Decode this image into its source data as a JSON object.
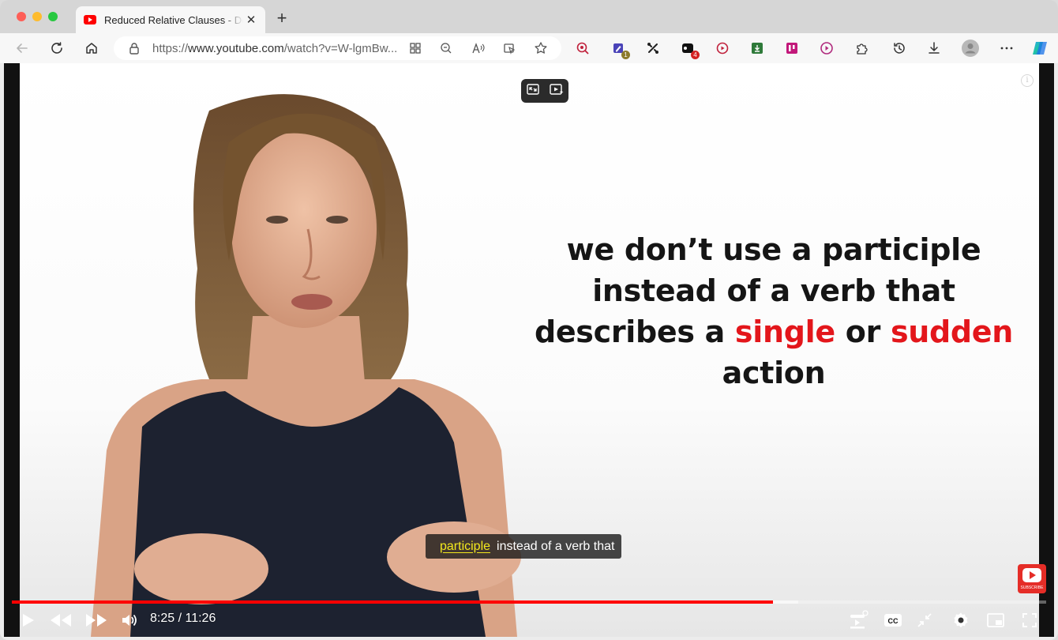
{
  "tab": {
    "title": "Reduced Relative Clauses - Definition and Examples"
  },
  "toolbar": {
    "url_prefix": "https://",
    "url_host": "www.youtube.com",
    "url_path": "/watch?v=W-lgmBw...",
    "extension_badges": {
      "ext2": "1",
      "ext4": "4"
    }
  },
  "video": {
    "slide": {
      "line1": "we don’t use a participle",
      "line2": "instead of a verb that",
      "line3_a": "describes a ",
      "line3_red1": "single",
      "line3_b": " or ",
      "line3_red2": "sudden",
      "line4": "action"
    },
    "caption": {
      "highlight": "participle",
      "rest": "instead of a verb that"
    },
    "subscribe_label": "SUBSCRIBE",
    "info_label": "i"
  },
  "player": {
    "current_time": "8:25",
    "duration": "11:26",
    "time_separator": " / ",
    "played_fraction": 0.736,
    "loaded_fraction": 0.76,
    "progress_color": "#ff0000"
  },
  "colors": {
    "accent_red": "#e3161b",
    "caption_highlight": "#f3e81d"
  }
}
